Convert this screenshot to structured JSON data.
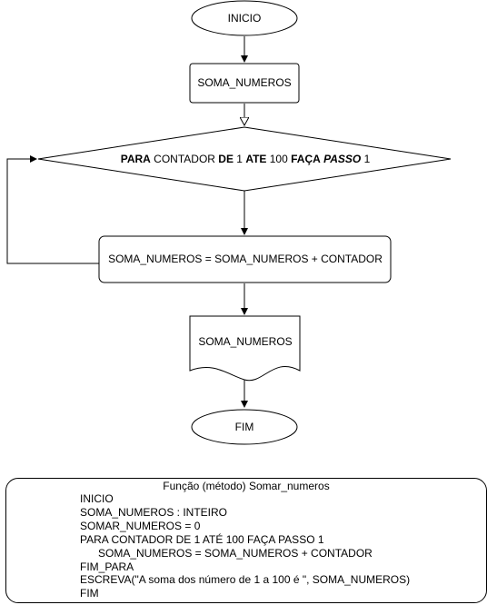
{
  "flowchart": {
    "start": "INICIO",
    "declare": "SOMA_NUMEROS",
    "loop": {
      "w1": "PARA",
      "w2": " CONTADOR ",
      "w3": "DE",
      "w4": " 1 ",
      "w5": "ATE",
      "w6": " 100 ",
      "w7": "FAÇA",
      "w8": " ",
      "w9": "PASSO",
      "w10": " 1"
    },
    "process": "SOMA_NUMEROS = SOMA_NUMEROS + CONTADOR",
    "output": "SOMA_NUMEROS",
    "end": "FIM"
  },
  "pseudocode": {
    "title": "Função (método) Somar_numeros",
    "lines": [
      "INICIO",
      "SOMA_NUMEROS : INTEIRO",
      "SOMAR_NUMEROS = 0",
      "PARA CONTADOR DE 1 ATÉ 100 FAÇA PASSO 1",
      "      SOMA_NUMEROS = SOMA_NUMEROS + CONTADOR",
      "FIM_PARA",
      "ESCREVA(\"A soma dos número de 1 a 100 é \", SOMA_NUMEROS)",
      "FIM"
    ]
  }
}
